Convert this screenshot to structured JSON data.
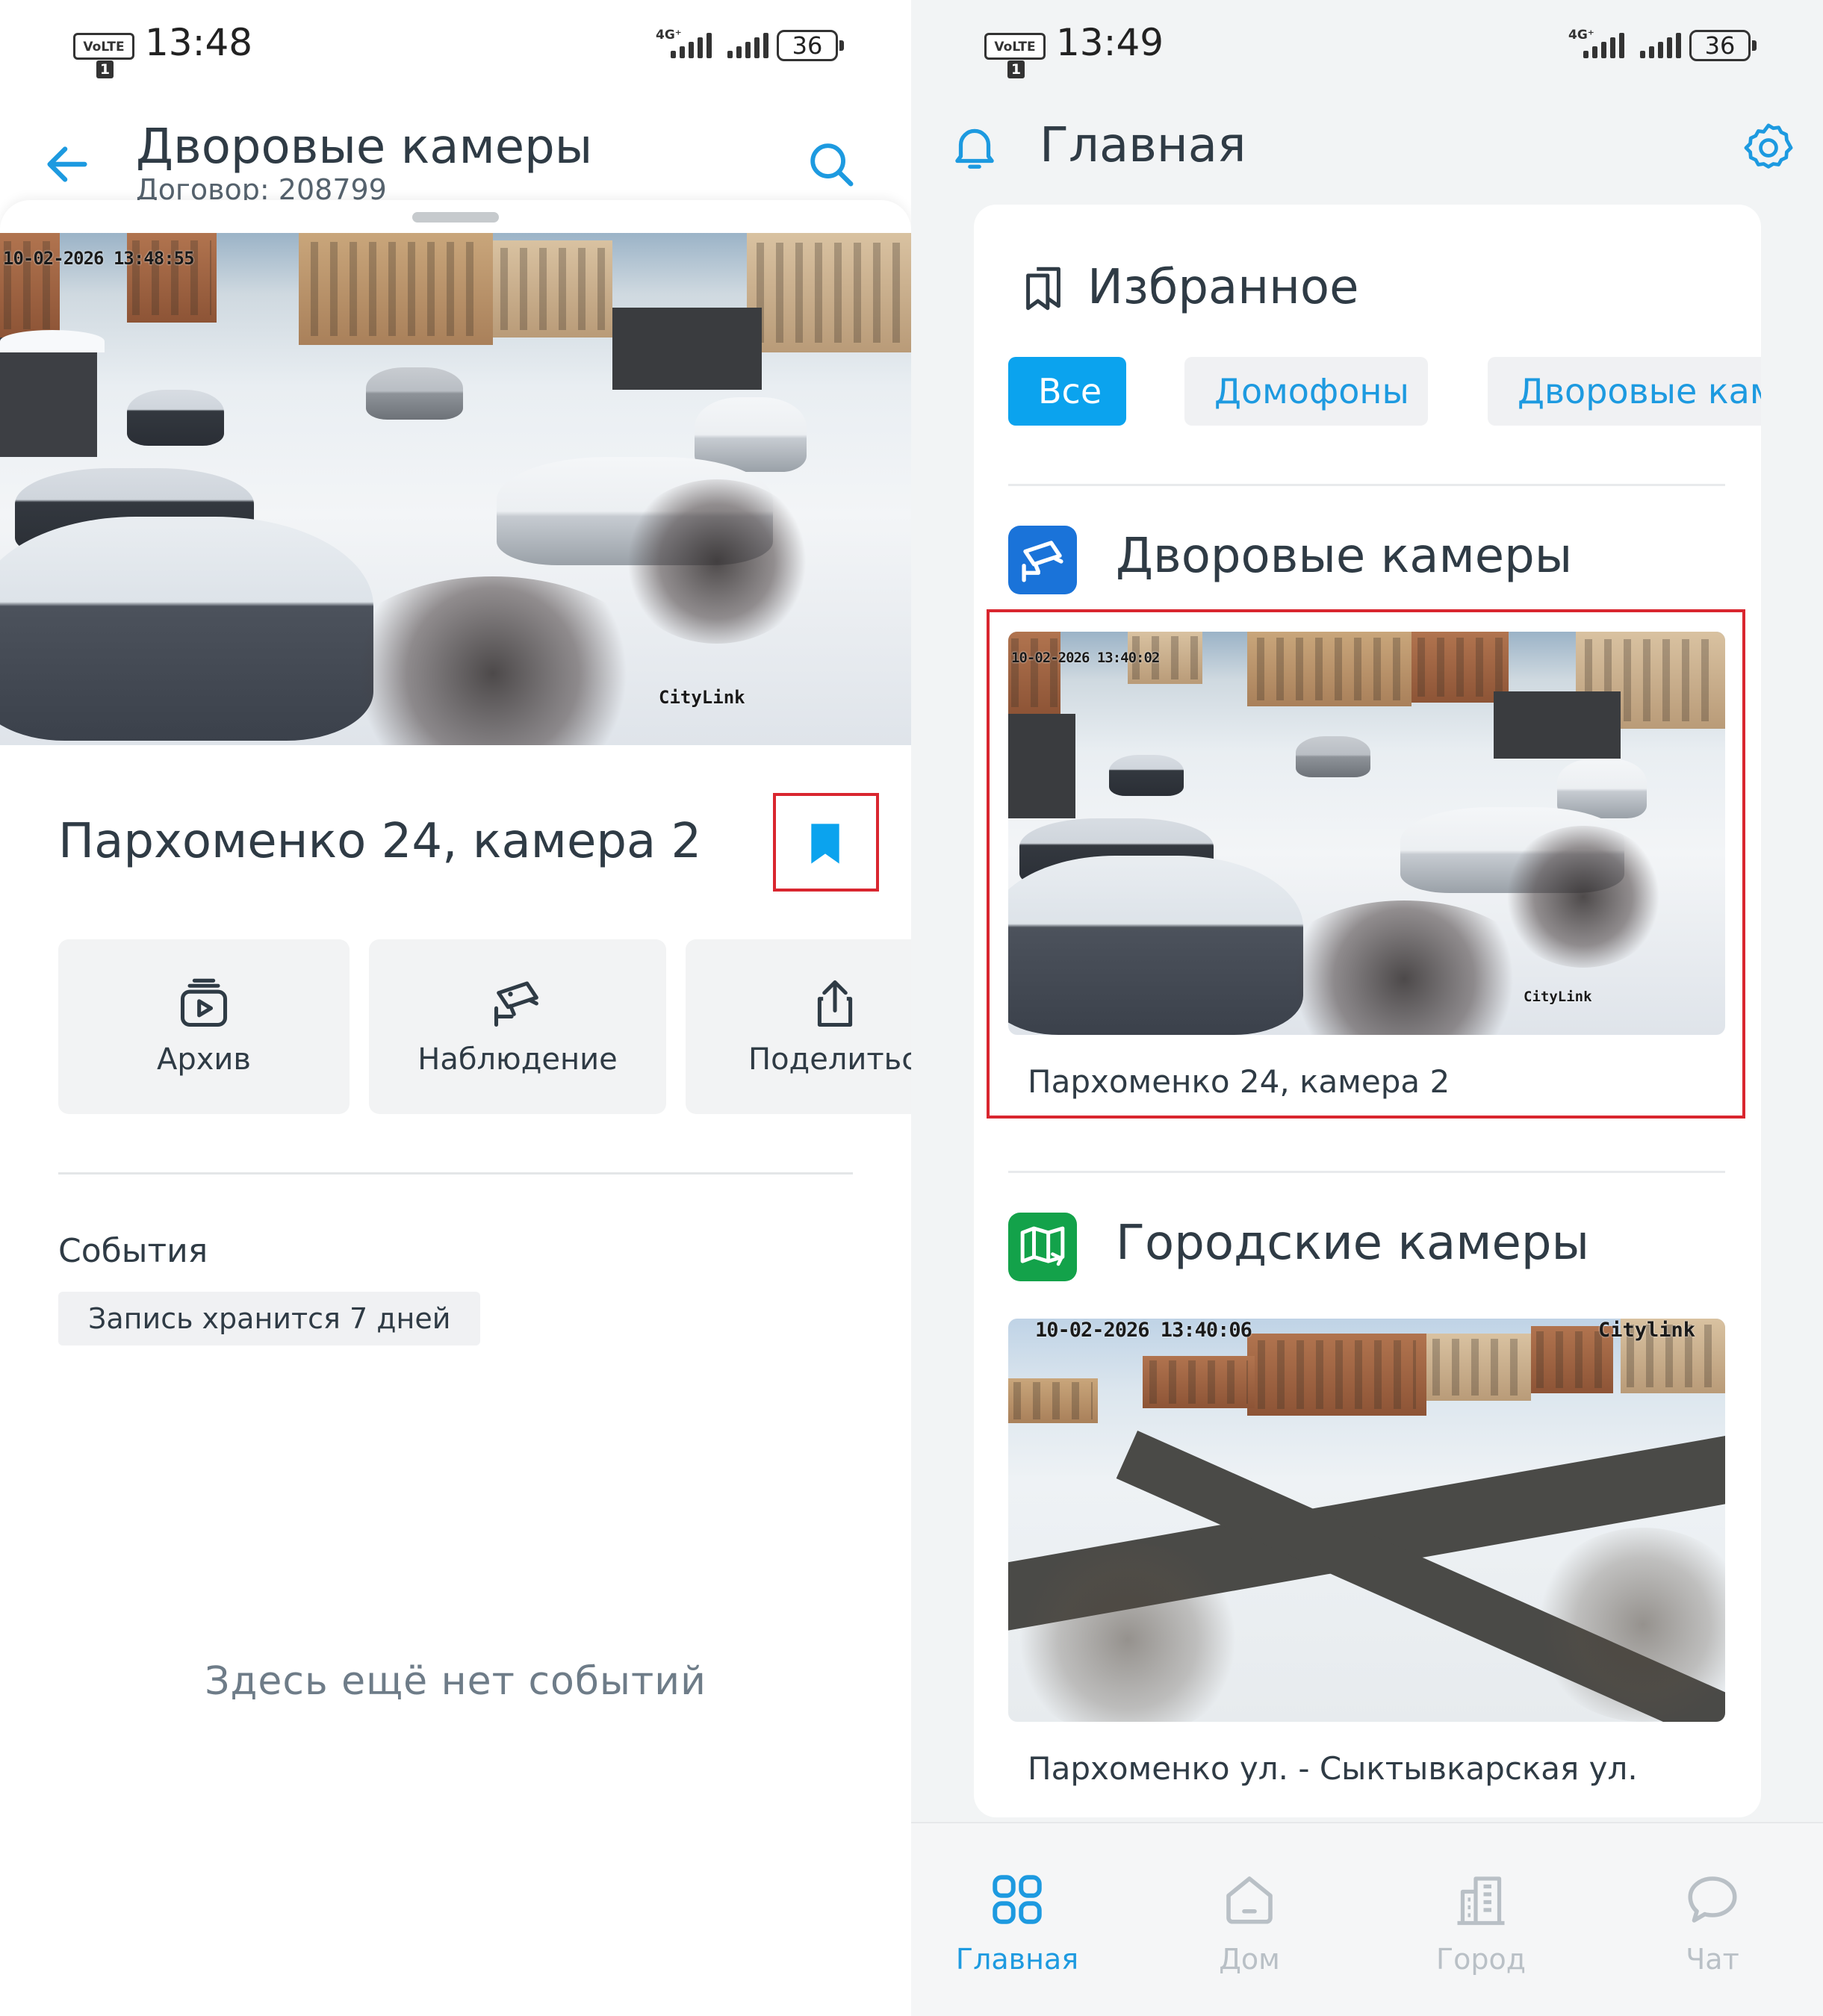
{
  "left": {
    "status": {
      "volte": "VoLTE",
      "sim": "1",
      "time": "13:48",
      "network": "4G⁺",
      "battery": "36"
    },
    "header": {
      "title": "Дворовые камеры",
      "subtitle": "Договор: 208799"
    },
    "camera": {
      "timestamp": "10-02-2026 13:48:55",
      "watermark": "CityLink",
      "title": "Пархоменко 24, камера 2"
    },
    "actions": [
      {
        "label": "Архив",
        "icon": "archive-play-icon"
      },
      {
        "label": "Наблюдение",
        "icon": "cctv-camera-icon"
      },
      {
        "label": "Поделиться",
        "icon": "share-icon"
      }
    ],
    "events": {
      "heading": "События",
      "retention": "Запись хранится 7 дней",
      "empty": "Здесь ещё нет событий"
    }
  },
  "right": {
    "status": {
      "volte": "VoLTE",
      "sim": "1",
      "time": "13:49",
      "network": "4G⁺",
      "battery": "36"
    },
    "header": {
      "title": "Главная"
    },
    "favorites": {
      "title": "Избранное",
      "chips": [
        {
          "label": "Все",
          "active": true
        },
        {
          "label": "Домофоны",
          "active": false
        },
        {
          "label": "Дворовые камеры",
          "active": false
        }
      ]
    },
    "sections": [
      {
        "title": "Дворовые камеры",
        "icon": "cctv-camera-icon",
        "icon_color": "#1a73d9",
        "timestamp": "10-02-2026 13:40:02",
        "watermark": "CityLink",
        "caption": "Пархоменко 24, камера 2"
      },
      {
        "title": "Городские камеры",
        "icon": "city-map-icon",
        "icon_color": "#13a24a",
        "timestamp": "10-02-2026 13:40:06",
        "watermark": "Citylink",
        "caption": "Пархоменко ул. - Сыктывкарская ул."
      }
    ],
    "tabs": [
      {
        "label": "Главная",
        "icon": "grid-icon",
        "active": true
      },
      {
        "label": "Дом",
        "icon": "home-icon",
        "active": false
      },
      {
        "label": "Город",
        "icon": "building-icon",
        "active": false
      },
      {
        "label": "Чат",
        "icon": "chat-icon",
        "active": false
      }
    ]
  },
  "colors": {
    "accent": "#1d9ae0",
    "chip_active": "#0ba3ee",
    "highlight": "#d9262f",
    "text": "#2f3b45"
  }
}
